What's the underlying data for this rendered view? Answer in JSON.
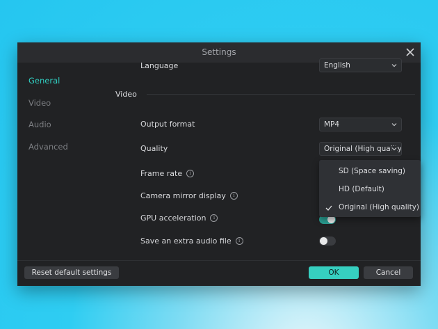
{
  "dialog": {
    "title": "Settings",
    "close_icon": "close-icon"
  },
  "sidebar": {
    "items": [
      {
        "label": "General",
        "active": true
      },
      {
        "label": "Video",
        "active": false
      },
      {
        "label": "Audio",
        "active": false
      },
      {
        "label": "Advanced",
        "active": false
      }
    ]
  },
  "general": {
    "language_label": "Language",
    "language_value": "English"
  },
  "video": {
    "section_title": "Video",
    "output_format_label": "Output format",
    "output_format_value": "MP4",
    "quality_label": "Quality",
    "quality_value": "Original (High quality)",
    "frame_rate_label": "Frame rate",
    "camera_mirror_label": "Camera mirror display",
    "gpu_label": "GPU acceleration",
    "gpu_enabled": true,
    "extra_audio_label": "Save an extra audio file",
    "extra_audio_enabled": false,
    "info_icon": "i"
  },
  "quality_dropdown": {
    "options": [
      {
        "label": "SD (Space saving)",
        "selected": false
      },
      {
        "label": "HD (Default)",
        "selected": false
      },
      {
        "label": "Original (High quality)",
        "selected": true
      }
    ]
  },
  "footer": {
    "reset_label": "Reset default settings",
    "ok_label": "OK",
    "cancel_label": "Cancel"
  },
  "colors": {
    "accent": "#36cfc0",
    "dialog_bg": "#212224",
    "background": "#25c6f0"
  }
}
